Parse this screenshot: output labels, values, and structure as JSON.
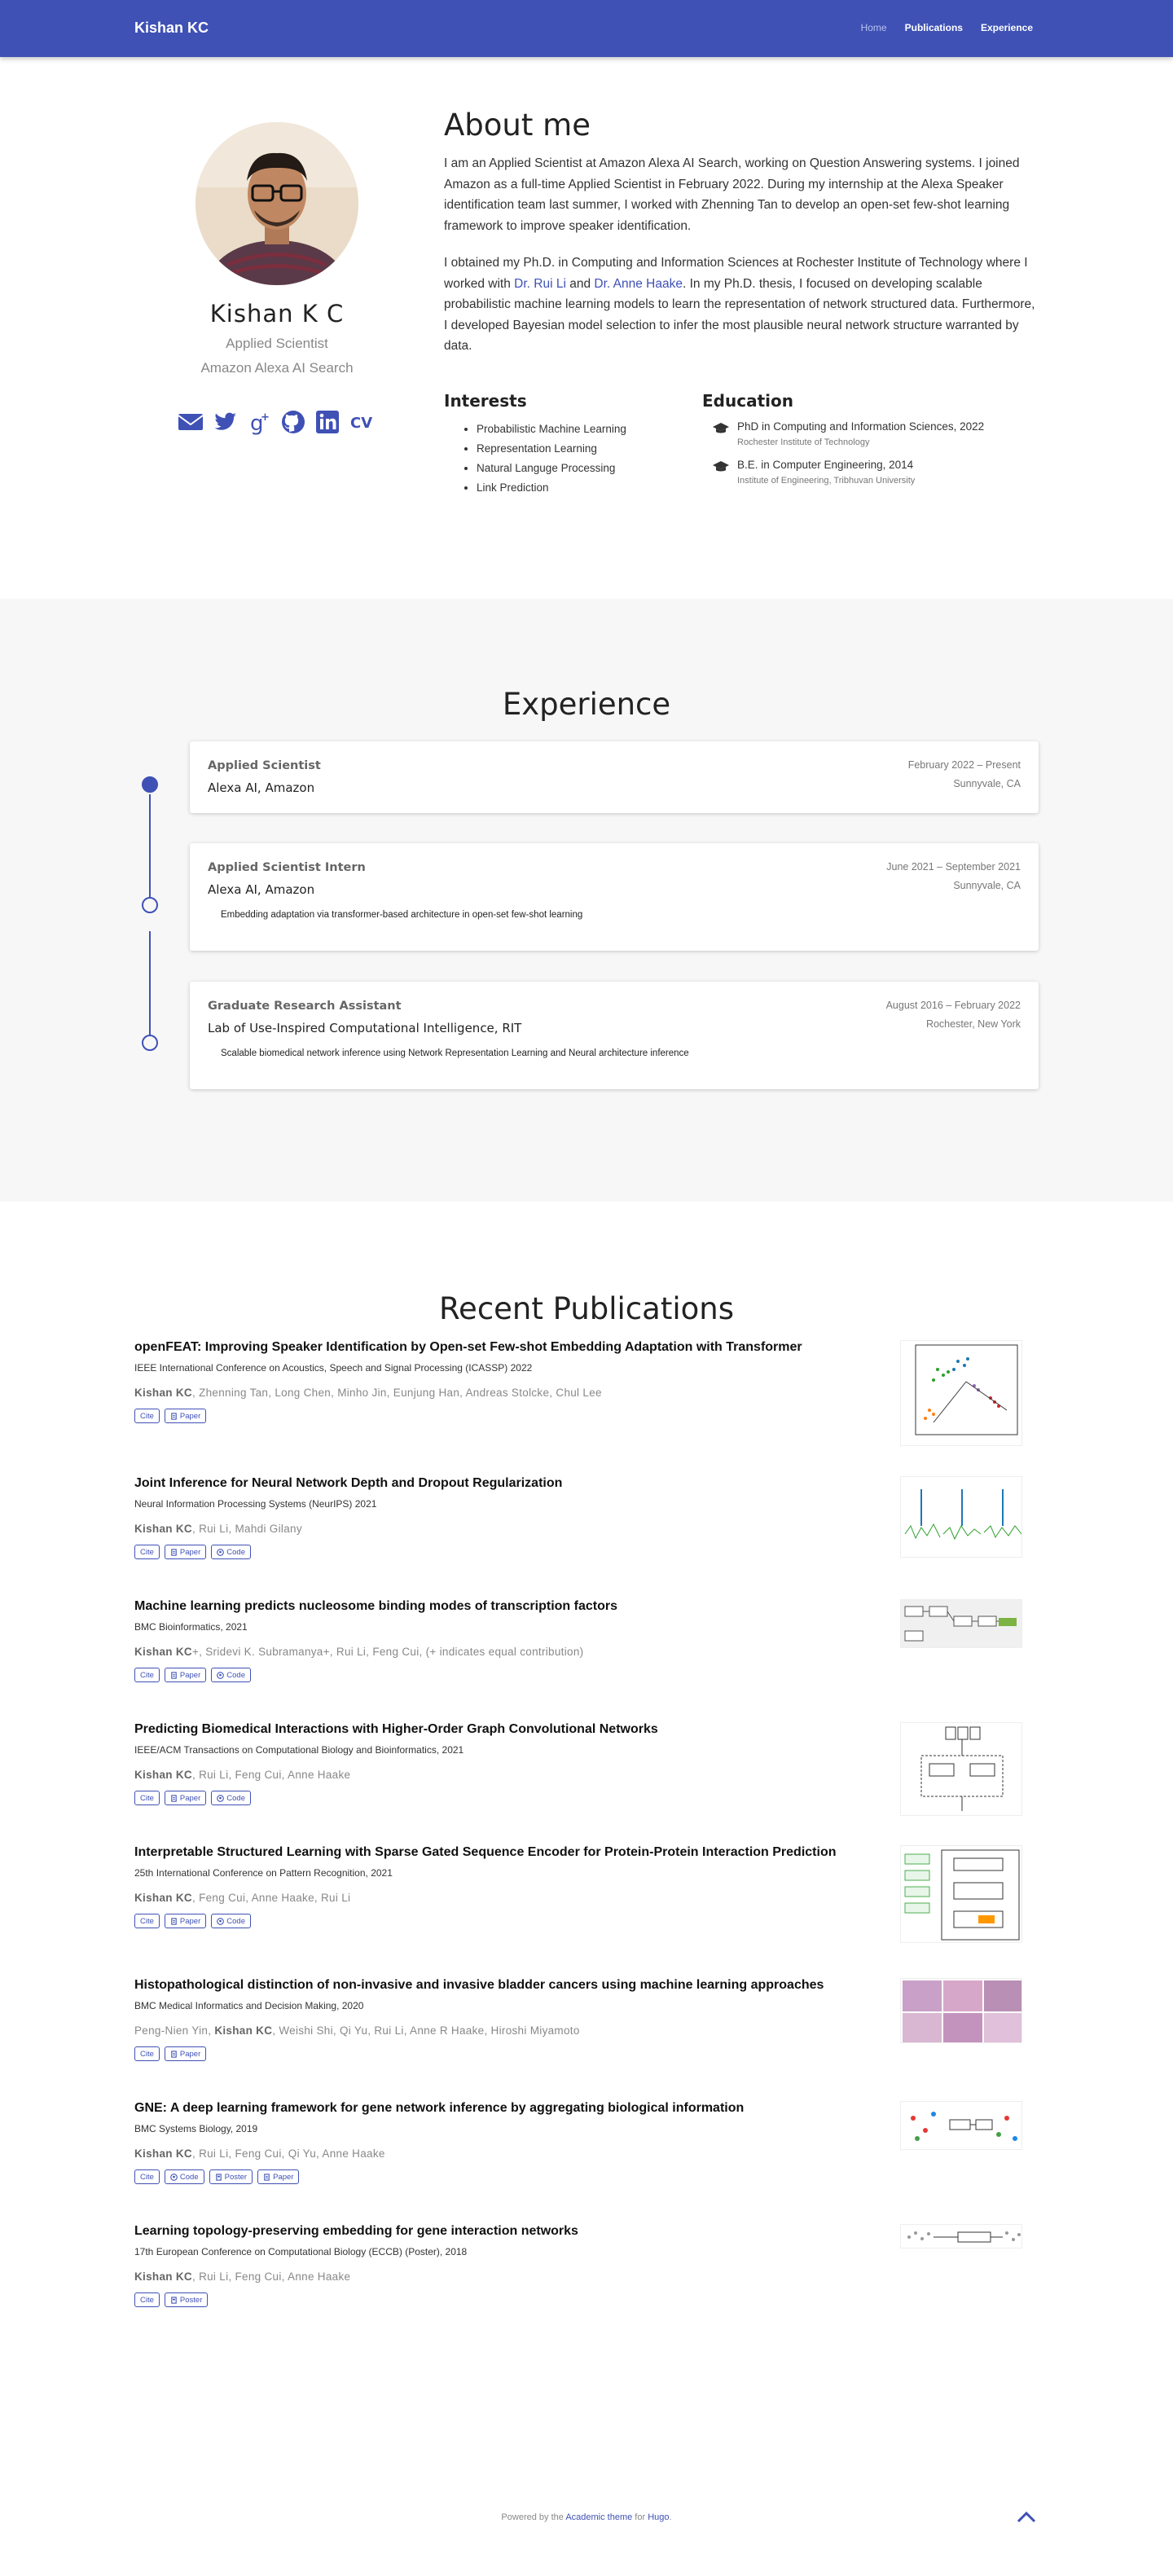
{
  "nav": {
    "brand": "Kishan KC",
    "links": [
      "Home",
      "Publications",
      "Experience"
    ]
  },
  "profile": {
    "name": "Kishan K C",
    "role": "Applied Scientist",
    "org": "Amazon Alexa AI Search",
    "social_icons": [
      "envelope-icon",
      "twitter-icon",
      "google-plus-icon",
      "github-icon",
      "linkedin-icon",
      "cv-icon"
    ],
    "cv_label": "CV"
  },
  "about": {
    "title": "About me",
    "p1": "I am an Applied Scientist at Amazon Alexa AI Search, working on Question Answering systems. I joined Amazon as a full-time Applied Scientist in February 2022. During my internship at the Alexa Speaker identification team last summer, I worked with Zhenning Tan to develop an open-set few-shot learning framework to improve speaker identification.",
    "p2_a": "I obtained my Ph.D. in Computing and Information Sciences at Rochester Institute of Technology where I worked with ",
    "p2_link1": "Dr. Rui Li",
    "p2_b": " and ",
    "p2_link2": "Dr. Anne Haake",
    "p2_c": ". In my Ph.D. thesis, I focused on developing scalable probabilistic machine learning models to learn the representation of network structured data. Furthermore, I developed Bayesian model selection to infer the most plausible neural network structure warranted by data.",
    "interests_title": "Interests",
    "interests": [
      "Probabilistic Machine Learning",
      "Representation Learning",
      "Natural Languge Processing",
      "Link Prediction"
    ],
    "education_title": "Education",
    "education": [
      {
        "degree": "PhD in Computing and Information Sciences, 2022",
        "institution": "Rochester Institute of Technology"
      },
      {
        "degree": "B.E. in Computer Engineering, 2014",
        "institution": "Institute of Engineering, Tribhuvan University"
      }
    ]
  },
  "experience": {
    "title": "Experience",
    "items": [
      {
        "role": "Applied Scientist",
        "org": "Alexa AI, Amazon",
        "dates": "February 2022 – Present",
        "location": "Sunnyvale, CA",
        "desc": ""
      },
      {
        "role": "Applied Scientist Intern",
        "org": "Alexa AI, Amazon",
        "dates": "June 2021 – September 2021",
        "location": "Sunnyvale, CA",
        "desc": "Embedding adaptation via transformer-based architecture in open-set few-shot learning"
      },
      {
        "role": "Graduate Research Assistant",
        "org": "Lab of Use-Inspired Computational Intelligence, RIT",
        "dates": "August 2016 – February 2022",
        "location": "Rochester, New York",
        "desc": "Scalable biomedical network inference using Network Representation Learning and Neural architecture inference"
      }
    ]
  },
  "publications": {
    "title": "Recent Publications",
    "items": [
      {
        "title": "openFEAT: Improving Speaker Identification by Open-set Few-shot Embedding Adaptation with Transformer",
        "venue": "IEEE International Conference on Acoustics, Speech and Signal Processing (ICASSP) 2022",
        "authors_before": "",
        "author_bold": "Kishan KC",
        "authors_after": ", Zhenning Tan, Long Chen, Minho Jin, Eunjung Han, Andreas Stolcke, Chul Lee",
        "buttons": [
          "Cite",
          "Paper"
        ]
      },
      {
        "title": "Joint Inference for Neural Network Depth and Dropout Regularization",
        "venue": "Neural Information Processing Systems (NeurIPS) 2021",
        "authors_before": "",
        "author_bold": "Kishan KC",
        "authors_after": ", Rui Li, Mahdi Gilany",
        "buttons": [
          "Cite",
          "Paper",
          "Code"
        ]
      },
      {
        "title": "Machine learning predicts nucleosome binding modes of transcription factors",
        "venue": "BMC Bioinformatics, 2021",
        "authors_before": "",
        "author_bold": "Kishan KC",
        "authors_after": "+, Sridevi K. Subramanya+, Rui Li, Feng Cui, (+ indicates equal contribution)",
        "buttons": [
          "Cite",
          "Paper",
          "Code"
        ]
      },
      {
        "title": "Predicting Biomedical Interactions with Higher-Order Graph Convolutional Networks",
        "venue": "IEEE/ACM Transactions on Computational Biology and Bioinformatics, 2021",
        "authors_before": "",
        "author_bold": "Kishan KC",
        "authors_after": ", Rui Li, Feng Cui, Anne Haake",
        "buttons": [
          "Cite",
          "Paper",
          "Code"
        ]
      },
      {
        "title": "Interpretable Structured Learning with Sparse Gated Sequence Encoder for Protein-Protein Interaction Prediction",
        "venue": "25th International Conference on Pattern Recognition, 2021",
        "authors_before": "",
        "author_bold": "Kishan KC",
        "authors_after": ", Feng Cui, Anne Haake, Rui Li",
        "buttons": [
          "Cite",
          "Paper",
          "Code"
        ]
      },
      {
        "title": "Histopathological distinction of non-invasive and invasive bladder cancers using machine learning approaches",
        "venue": "BMC Medical Informatics and Decision Making, 2020",
        "authors_before": "Peng-Nien Yin, ",
        "author_bold": "Kishan KC",
        "authors_after": ", Weishi Shi, Qi Yu, Rui Li, Anne R Haake, Hiroshi Miyamoto",
        "buttons": [
          "Cite",
          "Paper"
        ]
      },
      {
        "title": "GNE: A deep learning framework for gene network inference by aggregating biological information",
        "venue": "BMC Systems Biology, 2019",
        "authors_before": "",
        "author_bold": "Kishan KC",
        "authors_after": ", Rui Li, Feng Cui, Qi Yu, Anne Haake",
        "buttons": [
          "Cite",
          "Code",
          "Poster",
          "Paper"
        ]
      },
      {
        "title": "Learning topology-preserving embedding for gene interaction networks",
        "venue": "17th European Conference on Computational Biology (ECCB) (Poster), 2018",
        "authors_before": "",
        "author_bold": "Kishan KC",
        "authors_after": ", Rui Li, Feng Cui, Anne Haake",
        "buttons": [
          "Cite",
          "Poster"
        ]
      }
    ]
  },
  "footer": {
    "prefix": "Powered by the ",
    "theme_link": "Academic theme",
    "mid": " for ",
    "hugo_link": "Hugo",
    "suffix": "."
  },
  "colors": {
    "primary": "#3f51b5",
    "section_bg": "#f7f7f7"
  }
}
